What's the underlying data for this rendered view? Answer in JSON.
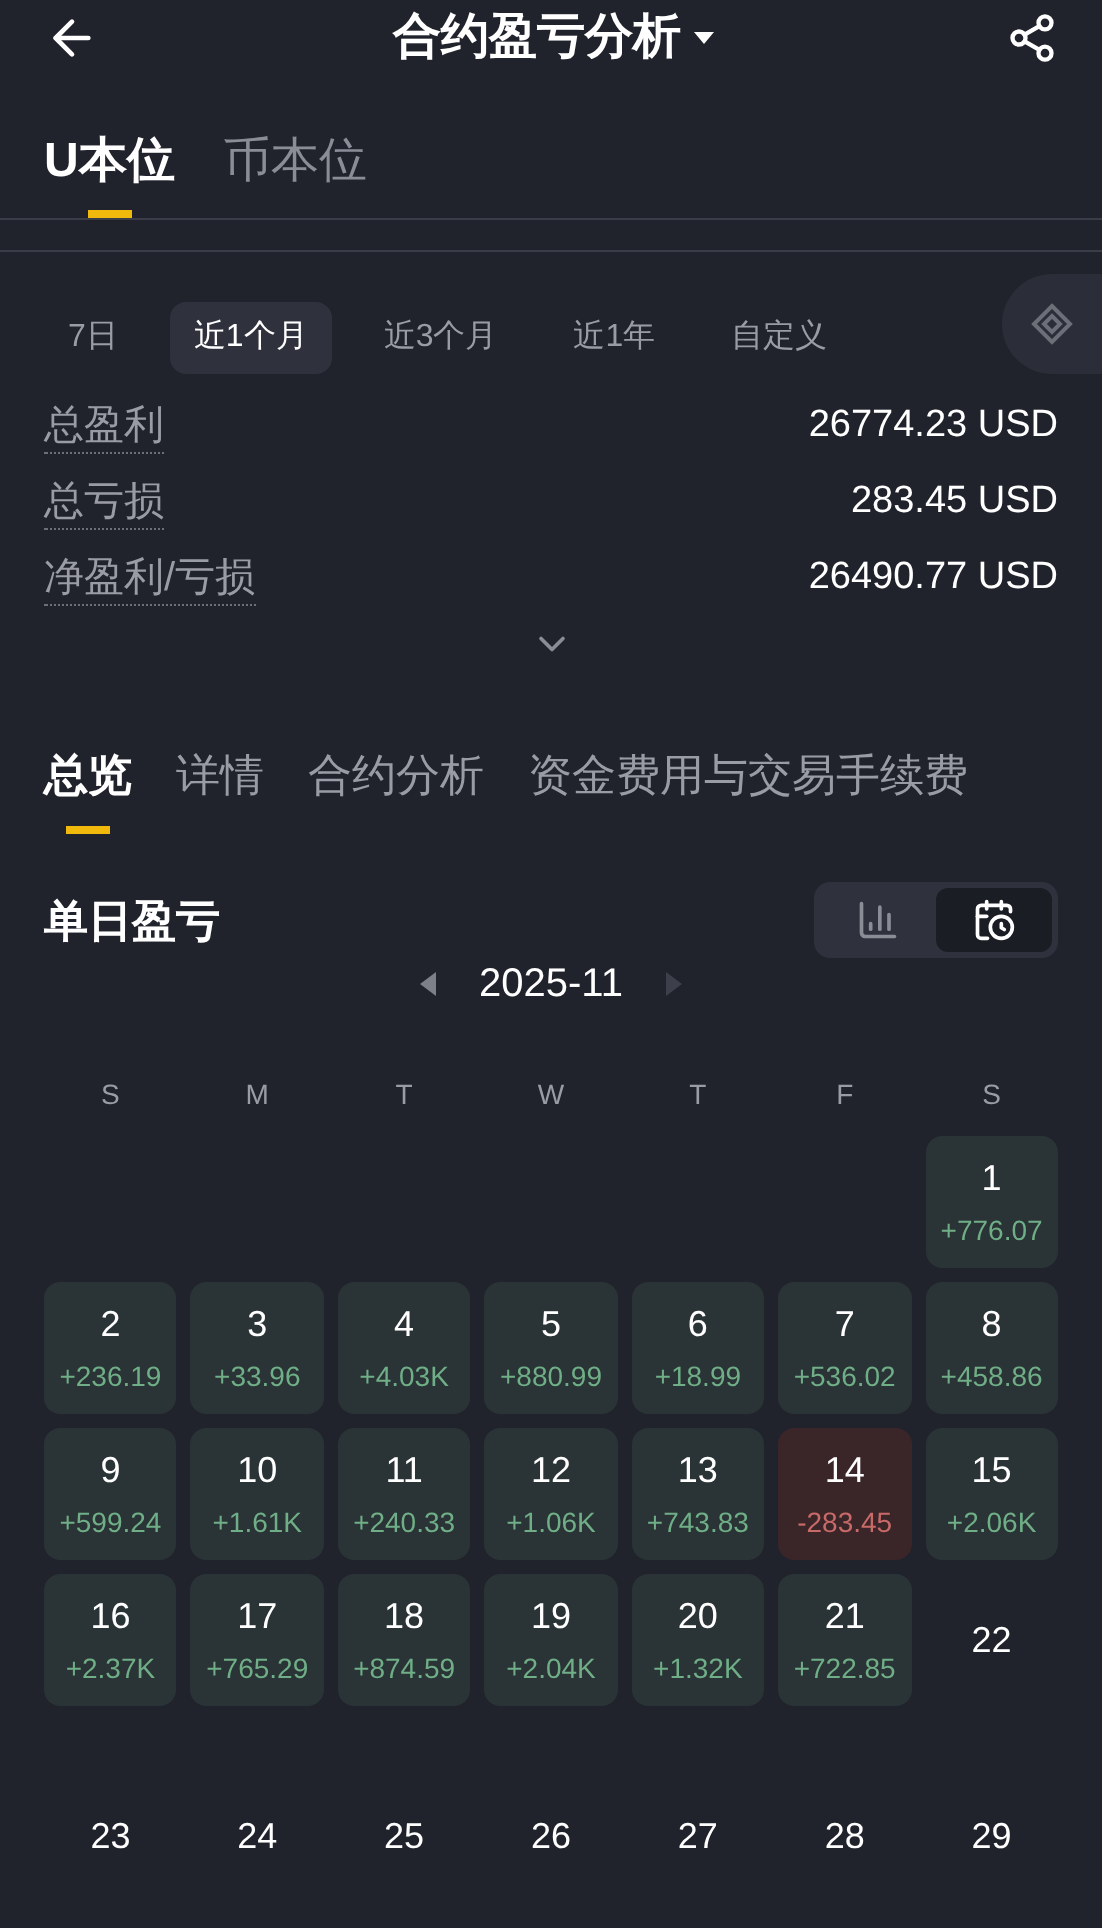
{
  "header": {
    "title": "合约盈亏分析"
  },
  "currency_tabs": [
    {
      "label": "U本位",
      "selected": true
    },
    {
      "label": "币本位",
      "selected": false
    }
  ],
  "periods": [
    {
      "label": "7日",
      "selected": false
    },
    {
      "label": "近1个月",
      "selected": true
    },
    {
      "label": "近3个月",
      "selected": false
    },
    {
      "label": "近1年",
      "selected": false
    },
    {
      "label": "自定义",
      "selected": false
    }
  ],
  "summary": [
    {
      "label": "总盈利",
      "value": "26774.23 USD"
    },
    {
      "label": "总亏损",
      "value": "283.45 USD"
    },
    {
      "label": "净盈利/亏损",
      "value": "26490.77 USD"
    }
  ],
  "section_tabs": [
    {
      "label": "总览",
      "selected": true
    },
    {
      "label": "详情",
      "selected": false
    },
    {
      "label": "合约分析",
      "selected": false
    },
    {
      "label": "资金费用与交易手续费",
      "selected": false
    }
  ],
  "daily": {
    "title": "单日盈亏",
    "views": [
      {
        "kind": "chart",
        "selected": false
      },
      {
        "kind": "calendar",
        "selected": true
      }
    ],
    "month": "2025-11",
    "weekdays": [
      "S",
      "M",
      "T",
      "W",
      "T",
      "F",
      "S"
    ],
    "days": [
      {
        "day": "1",
        "kind": "profit",
        "pnl": "+776.07"
      },
      {
        "day": "2",
        "kind": "profit",
        "pnl": "+236.19"
      },
      {
        "day": "3",
        "kind": "profit",
        "pnl": "+33.96"
      },
      {
        "day": "4",
        "kind": "profit",
        "pnl": "+4.03K"
      },
      {
        "day": "5",
        "kind": "profit",
        "pnl": "+880.99"
      },
      {
        "day": "6",
        "kind": "profit",
        "pnl": "+18.99"
      },
      {
        "day": "7",
        "kind": "profit",
        "pnl": "+536.02"
      },
      {
        "day": "8",
        "kind": "profit",
        "pnl": "+458.86"
      },
      {
        "day": "9",
        "kind": "profit",
        "pnl": "+599.24"
      },
      {
        "day": "10",
        "kind": "profit",
        "pnl": "+1.61K"
      },
      {
        "day": "11",
        "kind": "profit",
        "pnl": "+240.33"
      },
      {
        "day": "12",
        "kind": "profit",
        "pnl": "+1.06K"
      },
      {
        "day": "13",
        "kind": "profit",
        "pnl": "+743.83"
      },
      {
        "day": "14",
        "kind": "loss",
        "pnl": "-283.45"
      },
      {
        "day": "15",
        "kind": "profit",
        "pnl": "+2.06K"
      },
      {
        "day": "16",
        "kind": "profit",
        "pnl": "+2.37K"
      },
      {
        "day": "17",
        "kind": "profit",
        "pnl": "+765.29"
      },
      {
        "day": "18",
        "kind": "profit",
        "pnl": "+874.59"
      },
      {
        "day": "19",
        "kind": "profit",
        "pnl": "+2.04K"
      },
      {
        "day": "20",
        "kind": "profit",
        "pnl": "+1.32K"
      },
      {
        "day": "21",
        "kind": "profit",
        "pnl": "+722.85"
      },
      {
        "day": "22",
        "kind": "none"
      },
      {
        "day": "23",
        "kind": "none"
      },
      {
        "day": "24",
        "kind": "none"
      },
      {
        "day": "25",
        "kind": "none"
      },
      {
        "day": "26",
        "kind": "none"
      },
      {
        "day": "27",
        "kind": "none"
      },
      {
        "day": "28",
        "kind": "none"
      },
      {
        "day": "29",
        "kind": "none"
      }
    ]
  }
}
